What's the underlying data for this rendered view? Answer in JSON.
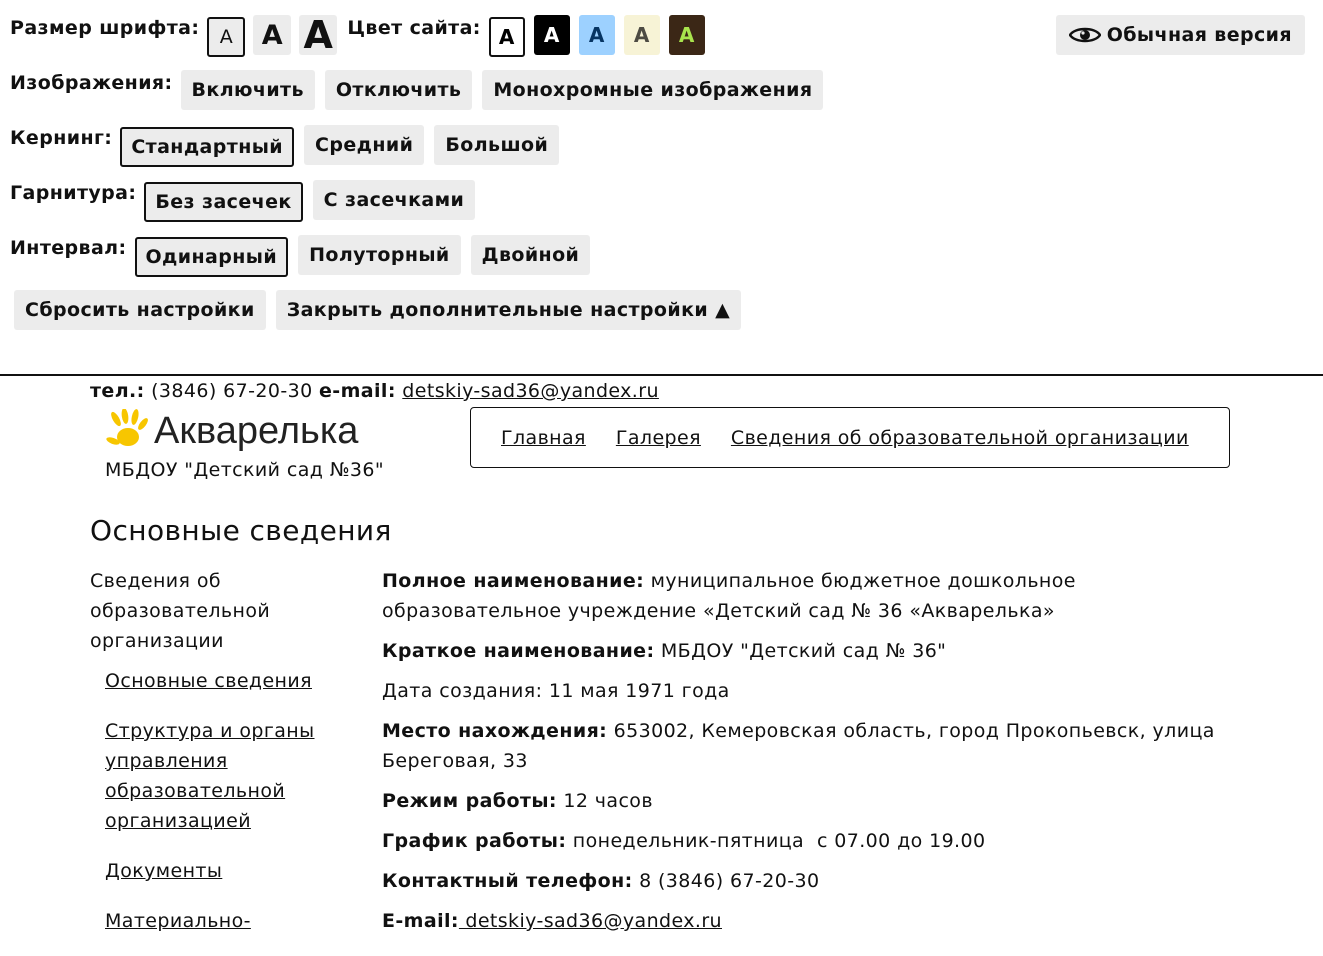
{
  "panel": {
    "font_size_label": "Размер шрифта:",
    "font_sizes": [
      "A",
      "A",
      "A"
    ],
    "color_label": "Цвет сайта:",
    "colors": [
      {
        "label": "A",
        "bg": "#ffffff",
        "fg": "#000000"
      },
      {
        "label": "A",
        "bg": "#000000",
        "fg": "#ffffff"
      },
      {
        "label": "A",
        "bg": "#9dd1ff",
        "fg": "#063462"
      },
      {
        "label": "A",
        "bg": "#f7f3d6",
        "fg": "#4d4b43"
      },
      {
        "label": "A",
        "bg": "#3b2716",
        "fg": "#a9e44d"
      }
    ],
    "normal_version": "Обычная версия",
    "images_label": "Изображения:",
    "images": [
      "Включить",
      "Отключить",
      "Монохромные изображения"
    ],
    "kerning_label": "Кернинг:",
    "kerning": [
      "Стандартный",
      "Средний",
      "Большой"
    ],
    "typeface_label": "Гарнитура:",
    "typeface": [
      "Без засечек",
      "С засечками"
    ],
    "interval_label": "Интервал:",
    "interval": [
      "Одинарный",
      "Полуторный",
      "Двойной"
    ],
    "reset": "Сбросить настройки",
    "close_more": "Закрыть дополнительные настройки ▲"
  },
  "site": {
    "phone_label": "тел.:",
    "phone": "(3846) 67-20-30",
    "email_label": "e-mail:",
    "email": "detskiy-sad36@yandex.ru",
    "logo_text": "Акварелька",
    "org_name": "МБДОУ \"Детский сад №36\"",
    "nav": [
      "Главная",
      "Галерея",
      "Сведения об образовательной организации"
    ],
    "accent_color": "#f7c600"
  },
  "main": {
    "title": "Основные сведения",
    "sidebar_head": "Сведения об образовательной организации",
    "sidebar_links": [
      "Основные сведения",
      "Структура и органы управления образовательной организацией",
      "Документы",
      "Материально-"
    ],
    "fields": [
      {
        "label": "Полное наименование:",
        "value": " муниципальное бюджетное дошкольное образовательное учреждение «Детский сад № 36 «Акварелька»"
      },
      {
        "label": "Краткое наименование:",
        "value": " МБДОУ \"Детский сад № 36\""
      },
      {
        "label": "",
        "value": "Дата создания: 11 мая 1971 года"
      },
      {
        "label": "Место нахождения:",
        "value": " 653002, Кемеровская область, город Прокопьевск, улица Береговая, 33"
      },
      {
        "label": "Режим работы:",
        "value": " 12 часов"
      },
      {
        "label": "График работы:",
        "value": " понедельник-пятница  с 07.00 до 19.00"
      },
      {
        "label": "Контактный телефон:",
        "value": " 8 (3846) 67-20-30"
      },
      {
        "label": "E-mail:",
        "value": " detskiy-sad36@yandex.ru"
      }
    ]
  }
}
